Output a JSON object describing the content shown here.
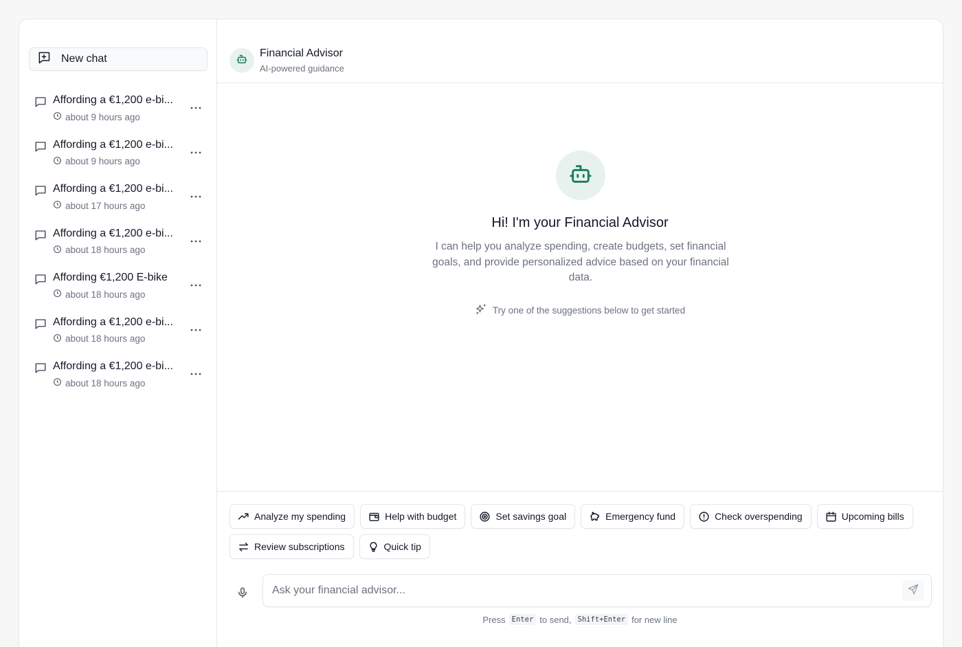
{
  "sidebar": {
    "new_chat_label": "New chat",
    "items": [
      {
        "title": "Affording a €1,200 e-bi...",
        "time": "about 9 hours ago"
      },
      {
        "title": "Affording a €1,200 e-bi...",
        "time": "about 9 hours ago"
      },
      {
        "title": "Affording a €1,200 e-bi...",
        "time": "about 17 hours ago"
      },
      {
        "title": "Affording a €1,200 e-bi...",
        "time": "about 18 hours ago"
      },
      {
        "title": "Affording €1,200 E-bike",
        "time": "about 18 hours ago"
      },
      {
        "title": "Affording a €1,200 e-bi...",
        "time": "about 18 hours ago"
      },
      {
        "title": "Affording a €1,200 e-bi...",
        "time": "about 18 hours ago"
      }
    ]
  },
  "header": {
    "name": "Financial Advisor",
    "subtitle": "AI-powered guidance"
  },
  "welcome": {
    "heading": "Hi! I'm your Financial Advisor",
    "description": "I can help you analyze spending, create budgets, set financial goals, and provide personalized advice based on your financial data.",
    "hint": "Try one of the suggestions below to get started"
  },
  "suggestions": {
    "row1": [
      {
        "label": "Analyze my spending",
        "icon": "trending-up-icon"
      },
      {
        "label": "Help with budget",
        "icon": "wallet-icon"
      },
      {
        "label": "Set savings goal",
        "icon": "target-icon"
      },
      {
        "label": "Emergency fund",
        "icon": "piggy-bank-icon"
      },
      {
        "label": "Check overspending",
        "icon": "alert-circle-icon"
      },
      {
        "label": "Upcoming bills",
        "icon": "calendar-icon"
      }
    ],
    "row2": [
      {
        "label": "Review subscriptions",
        "icon": "arrows-exchange-icon"
      },
      {
        "label": "Quick tip",
        "icon": "lightbulb-icon"
      }
    ]
  },
  "composer": {
    "placeholder": "Ask your financial advisor...",
    "hint_press": "Press",
    "hint_enter": "Enter",
    "hint_to_send": "to send,",
    "hint_shift_enter": "Shift+Enter",
    "hint_new_line": "for new line"
  },
  "colors": {
    "accent": "#1a7a55",
    "accent_bg": "#e7f2ee",
    "muted_text": "#6b7280",
    "border": "#e5e7eb"
  }
}
